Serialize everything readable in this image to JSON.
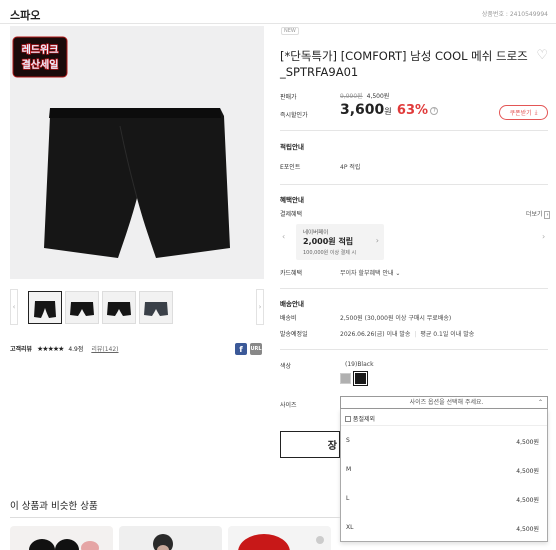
{
  "header": {
    "brand": "스파오",
    "product_code_text": "상품번호 : 2410549994"
  },
  "product": {
    "new_tag": "NEW",
    "title": "[*단독특가] [COMFORT] 남성 COOL 메쉬 드로즈_SPTRFA9A01",
    "badge_line1": "레드위크",
    "badge_line2": "결산세일"
  },
  "price": {
    "sale_label": "판매가",
    "original_price": "9,990원",
    "sale_price": "4,500원",
    "instant_label": "즉시할인가",
    "final_price": "3,600",
    "final_unit": "원",
    "discount_rate": "63%",
    "coupon_label": "쿠폰받기"
  },
  "points": {
    "heading": "적립안내",
    "point_label": "E포인트",
    "point_value": "4P 적립"
  },
  "benefits": {
    "heading": "혜택안내",
    "pay_label": "결제혜택",
    "more_label": "더보기",
    "naver_title": "네이버페이",
    "naver_amount": "2,000원 적립",
    "naver_condition": "100,000원 이상 결제 시",
    "card_label": "카드혜택",
    "card_value": "무이자 할부혜택 안내"
  },
  "delivery": {
    "heading": "배송안내",
    "fee_label": "배송비",
    "fee_value": "2,500원 (30,000원 이상 구매시 무료배송)",
    "date_label": "발송예정일",
    "date_value": "2026.06.26(금) 이내 발송",
    "avg_value": "평균 0.1일 이내 발송"
  },
  "options": {
    "color_label": "색상",
    "color_value": "(19)Black",
    "size_label": "사이즈",
    "size_placeholder": "사이즈 옵션을 선택해 주세요.",
    "soldout_filter": "품절제외",
    "sizes": [
      {
        "name": "S",
        "price": "4,500원"
      },
      {
        "name": "M",
        "price": "4,500원"
      },
      {
        "name": "L",
        "price": "4,500원"
      },
      {
        "name": "XL",
        "price": "4,500원"
      }
    ]
  },
  "cart_button_partial": "장",
  "reviews": {
    "label": "고객리뷰",
    "stars": "★★★★★",
    "score": "4.9점",
    "count_text": "리뷰(142)"
  },
  "similar": {
    "heading": "이 상품과 비슷한 상품"
  },
  "colors": {
    "accent_red": "#e03a3a",
    "swatch_gray": "#b0b0b0",
    "swatch_black": "#1a1a1a",
    "facebook": "#3b5998"
  }
}
